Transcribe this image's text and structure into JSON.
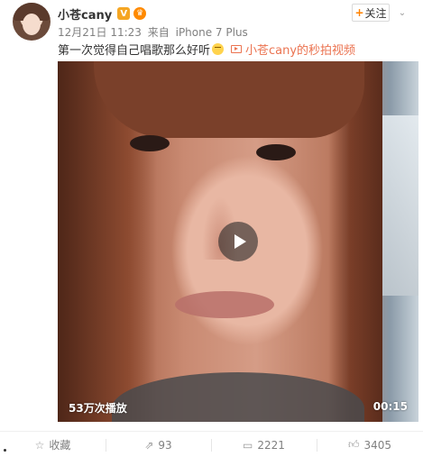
{
  "user": {
    "name": "小苍cany",
    "verified_badge": "V",
    "member_badge": "♛"
  },
  "meta": {
    "time": "12月21日 11:23",
    "source_prefix": "来自",
    "source": "iPhone 7 Plus"
  },
  "follow": {
    "plus": "+",
    "label": "关注"
  },
  "post": {
    "text": "第一次觉得自己唱歌那么好听",
    "video_link_label": "小苍cany的秒拍视频"
  },
  "video": {
    "play_count": "53万次播放",
    "duration": "00:15"
  },
  "actions": {
    "favorite": "收藏",
    "repost": "93",
    "comment": "2221",
    "like": "3405"
  },
  "icons": {
    "favorite": "star-icon",
    "repost": "repost-icon",
    "comment": "comment-icon",
    "like": "thumbs-up-icon"
  },
  "colors": {
    "link": "#eb7350",
    "follow_plus": "#ff8200",
    "meta_text": "#808080"
  }
}
